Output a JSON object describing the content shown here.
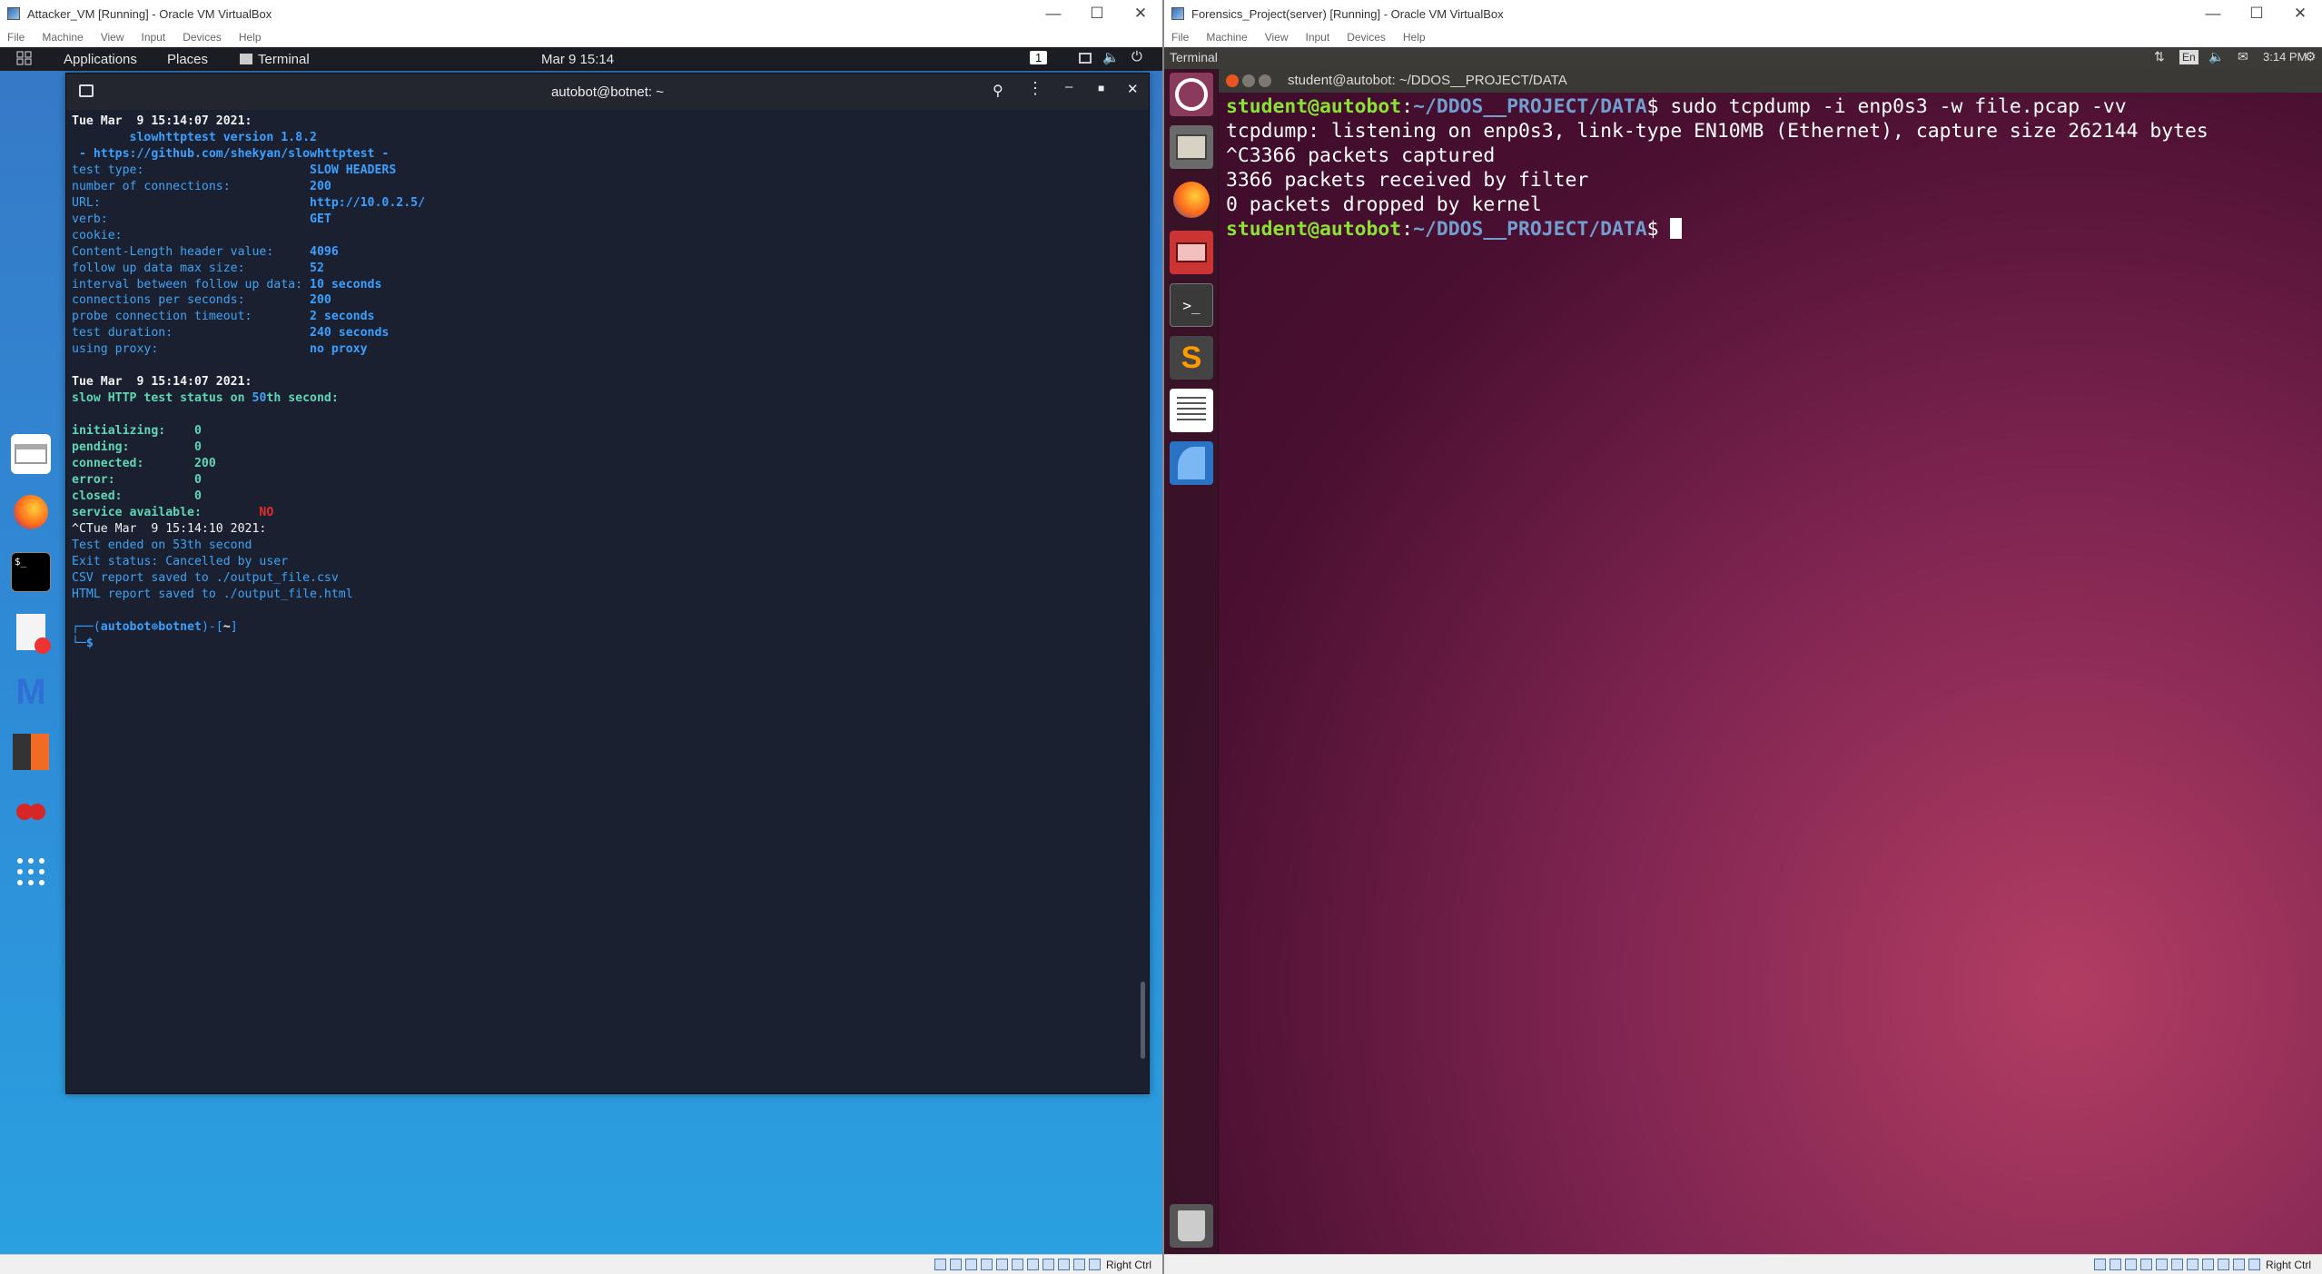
{
  "left_vm": {
    "title": "Attacker_VM [Running] - Oracle VM VirtualBox",
    "menu": [
      "File",
      "Machine",
      "View",
      "Input",
      "Devices",
      "Help"
    ],
    "host_key": "Right Ctrl",
    "panel": {
      "applications": "Applications",
      "places": "Places",
      "terminal": "Terminal",
      "clock": "Mar 9  15:14",
      "workspace": "1"
    },
    "dock_icons": [
      "files-icon",
      "firefox-icon",
      "terminal-icon",
      "text-editor-icon",
      "metasploit-icon",
      "burpsuite-icon",
      "cherrytree-icon",
      "app-grid-icon"
    ],
    "terminal": {
      "title": "autobot@botnet: ~",
      "lines": {
        "l1": "Tue Mar  9 15:14:07 2021:",
        "l2": "        slowhttptest version 1.8.2",
        "l3": " - https://github.com/shekyan/slowhttptest -",
        "cfg": [
          {
            "k": "test type:",
            "v": "SLOW HEADERS"
          },
          {
            "k": "number of connections:",
            "v": "200"
          },
          {
            "k": "URL:",
            "v": "http://10.0.2.5/"
          },
          {
            "k": "verb:",
            "v": "GET"
          },
          {
            "k": "cookie:",
            "v": ""
          },
          {
            "k": "Content-Length header value:",
            "v": "4096"
          },
          {
            "k": "follow up data max size:",
            "v": "52"
          },
          {
            "k": "interval between follow up data:",
            "v": "10 seconds"
          },
          {
            "k": "connections per seconds:",
            "v": "200"
          },
          {
            "k": "probe connection timeout:",
            "v": "2 seconds"
          },
          {
            "k": "test duration:",
            "v": "240 seconds"
          },
          {
            "k": "using proxy:",
            "v": "no proxy"
          }
        ],
        "l4": "Tue Mar  9 15:14:07 2021:",
        "status_pre": "slow HTTP test status on ",
        "status_sec": "50",
        "status_post": "th second:",
        "stats": [
          {
            "k": "initializing:",
            "v": "0"
          },
          {
            "k": "pending:",
            "v": "0"
          },
          {
            "k": "connected:",
            "v": "200"
          },
          {
            "k": "error:",
            "v": "0"
          },
          {
            "k": "closed:",
            "v": "0"
          }
        ],
        "svc_k": "service available:",
        "svc_v": "NO",
        "l5": "^CTue Mar  9 15:14:10 2021:",
        "l6": "Test ended on 53th second",
        "l7": "Exit status: Cancelled by user",
        "l8": "CSV report saved to ./output_file.csv",
        "l9": "HTML report saved to ./output_file.html",
        "prompt_user": "autobot",
        "prompt_at": "⊛",
        "prompt_host": "botnet",
        "prompt_dir": "~",
        "prompt_sym": "$"
      }
    }
  },
  "right_vm": {
    "title": "Forensics_Project(server) [Running] - Oracle VM VirtualBox",
    "menu": [
      "File",
      "Machine",
      "View",
      "Input",
      "Devices",
      "Help"
    ],
    "host_key": "Right Ctrl",
    "panel": {
      "app_name": "Terminal",
      "lang": "En",
      "clock": "3:14 PM"
    },
    "launcher_icons": [
      "ubuntu-dash-icon",
      "files-icon",
      "firefox-icon",
      "app-icon",
      "terminal-icon",
      "sublime-text-icon",
      "text-doc-icon",
      "wireshark-icon",
      "trash-icon"
    ],
    "terminal": {
      "title": "student@autobot: ~/DDOS__PROJECT/DATA",
      "prompt_user": "student@autobot",
      "prompt_path": "~/DDOS__PROJECT/DATA",
      "cmd": "$ sudo tcpdump -i enp0s3 -w file.pcap -vv",
      "out1": "tcpdump: listening on enp0s3, link-type EN10MB (Ethernet), capture size 262144 bytes",
      "out2": "^C3366 packets captured",
      "out3": "3366 packets received by filter",
      "out4": "0 packets dropped by kernel",
      "prompt2_sym": "$ "
    }
  }
}
